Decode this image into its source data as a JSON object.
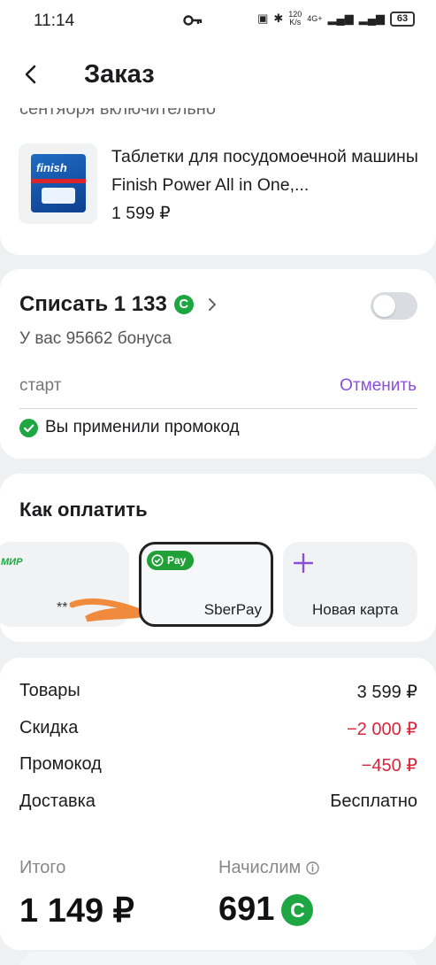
{
  "status_bar": {
    "time": "11:14",
    "net_speed_value": "120",
    "net_speed_unit": "K/s",
    "network": "4G+",
    "battery": "63"
  },
  "header": {
    "title": "Заказ"
  },
  "product": {
    "note_text": "сентября включительно",
    "name": "Таблетки для посудомоечной машины Finish Power All in One,...",
    "price": "1 599 ₽",
    "pack_logo": "finish"
  },
  "bonus": {
    "title": "Списать 1 133",
    "coin_symbol": "С",
    "balance_text": "У вас 95662 бонуса",
    "toggle_on": false
  },
  "promo": {
    "code": "старт",
    "cancel_label": "Отменить",
    "applied_text": "Вы применили промокод"
  },
  "payment": {
    "title": "Как оплатить",
    "card_brand": "МИР",
    "card_mask": "**",
    "sber_badge": "Pay",
    "sber_label": "SberPay",
    "new_card_label": "Новая карта"
  },
  "summary": {
    "rows": [
      {
        "label": "Товары",
        "value": "3 599 ₽"
      },
      {
        "label": "Скидка",
        "value": "−2 000 ₽"
      },
      {
        "label": "Промокод",
        "value": "−450 ₽"
      },
      {
        "label": "Доставка",
        "value": "Бесплатно"
      }
    ],
    "total_label": "Итого",
    "total_value": "1 149 ₽",
    "accrue_label": "Начислим",
    "accrue_value": "691",
    "accrue_coin": "С"
  },
  "colors": {
    "accent_purple": "#8a4fd8",
    "bonus_green": "#1ea642",
    "discount_red": "#d7263d"
  }
}
